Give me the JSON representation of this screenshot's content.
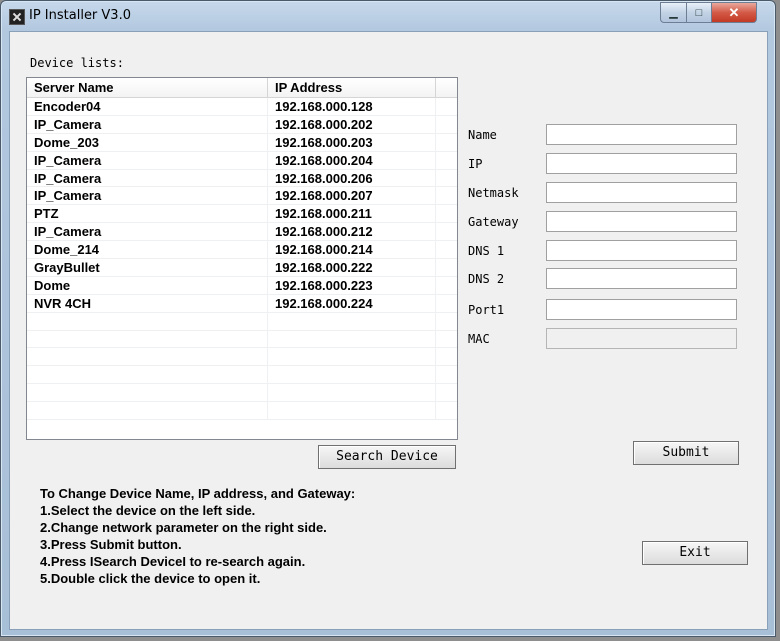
{
  "window": {
    "title": "IP Installer V3.0",
    "min_label": "▁",
    "max_label": "□",
    "close_label": "✕"
  },
  "device_list_label": "Device lists:",
  "table": {
    "columns": [
      "Server Name",
      "IP Address"
    ],
    "rows": [
      [
        "Encoder04",
        "192.168.000.128"
      ],
      [
        "IP_Camera",
        "192.168.000.202"
      ],
      [
        "Dome_203",
        "192.168.000.203"
      ],
      [
        "IP_Camera",
        "192.168.000.204"
      ],
      [
        "IP_Camera",
        "192.168.000.206"
      ],
      [
        "IP_Camera",
        "192.168.000.207"
      ],
      [
        "PTZ",
        "192.168.000.211"
      ],
      [
        "IP_Camera",
        "192.168.000.212"
      ],
      [
        "Dome_214",
        "192.168.000.214"
      ],
      [
        "GrayBullet",
        "192.168.000.222"
      ],
      [
        "Dome",
        "192.168.000.223"
      ],
      [
        "NVR 4CH",
        "192.168.000.224"
      ],
      [
        "",
        ""
      ],
      [
        "",
        ""
      ],
      [
        "",
        ""
      ],
      [
        "",
        ""
      ],
      [
        "",
        ""
      ],
      [
        "",
        ""
      ]
    ]
  },
  "search_button": "Search Device",
  "form": {
    "fields": [
      {
        "label": "Name",
        "value": ""
      },
      {
        "label": "IP",
        "value": ""
      },
      {
        "label": "Netmask",
        "value": ""
      },
      {
        "label": "Gateway",
        "value": ""
      },
      {
        "label": "DNS 1",
        "value": ""
      },
      {
        "label": "DNS 2",
        "value": ""
      },
      {
        "label": "Port1",
        "value": ""
      },
      {
        "label": "MAC",
        "value": ""
      }
    ],
    "submit_label": "Submit",
    "exit_label": "Exit"
  },
  "instructions": [
    "To Change Device Name, IP address, and Gateway:",
    "1.Select the device on the left side.",
    "2.Change network parameter on the right side.",
    "3.Press Submit button.",
    "4.Press ISearch DeviceI to re-search again.",
    "5.Double click the device to open it."
  ]
}
